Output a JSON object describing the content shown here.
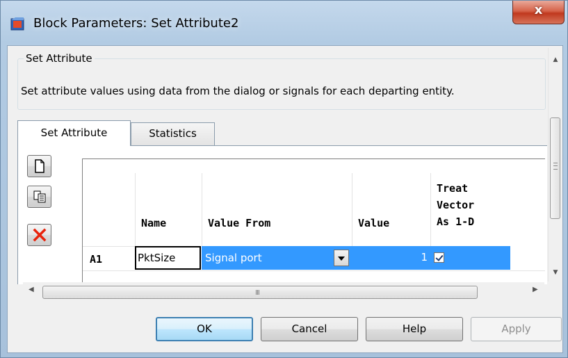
{
  "window": {
    "title": "Block Parameters: Set Attribute2",
    "close_label": "x"
  },
  "group": {
    "title": "Set Attribute",
    "description": "Set attribute values using data from the dialog or signals for each departing entity."
  },
  "tabs": [
    {
      "label": "Set Attribute",
      "active": true
    },
    {
      "label": "Statistics",
      "active": false
    }
  ],
  "side_buttons": [
    "new-icon",
    "copy-icon",
    "delete-icon"
  ],
  "table": {
    "columns": {
      "name": "Name",
      "value_from": "Value From",
      "value": "Value",
      "treat_line1": "Treat",
      "treat_line2": "Vector",
      "treat_line3": "As 1-D"
    },
    "rows": [
      {
        "id": "A1",
        "name": "PktSize",
        "value_from": "Signal port",
        "value": "1",
        "treat_vector": true
      }
    ]
  },
  "scrollbar": {
    "grip": "III"
  },
  "buttons": {
    "ok": "OK",
    "cancel": "Cancel",
    "help": "Help",
    "apply": "Apply"
  },
  "colors": {
    "selection": "#3399ff",
    "delete_icon": "#e8230c"
  }
}
